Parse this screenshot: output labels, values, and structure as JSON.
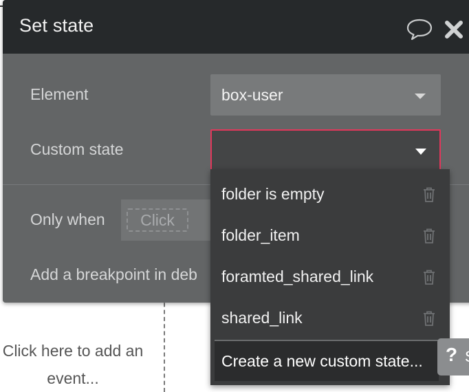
{
  "background": {
    "event_text": "Click here to add an event..."
  },
  "modal": {
    "title": "Set state",
    "comment_icon": "speech-bubble-icon",
    "close_icon": "close-x-icon",
    "element_label": "Element",
    "element_value": "box-user",
    "custom_state_label": "Custom state",
    "custom_state_value": "",
    "only_when_label": "Only when",
    "only_when_placeholder": "Click",
    "breakpoint_label": "Add a breakpoint in deb"
  },
  "dropdown": {
    "items": [
      {
        "label": "folder is empty",
        "icon": "trash-icon"
      },
      {
        "label": "folder_item",
        "icon": "trash-icon"
      },
      {
        "label": "foramted_shared_link",
        "icon": "trash-icon"
      },
      {
        "label": "shared_link",
        "icon": "trash-icon"
      }
    ],
    "create_label": "Create a new custom state..."
  },
  "help": {
    "label": "?",
    "partial": "S"
  },
  "colors": {
    "header_bg": "#26292b",
    "modal_bg": "#636566",
    "accent_border": "#e2375b",
    "dropdown_bg": "#3b3c3d"
  }
}
